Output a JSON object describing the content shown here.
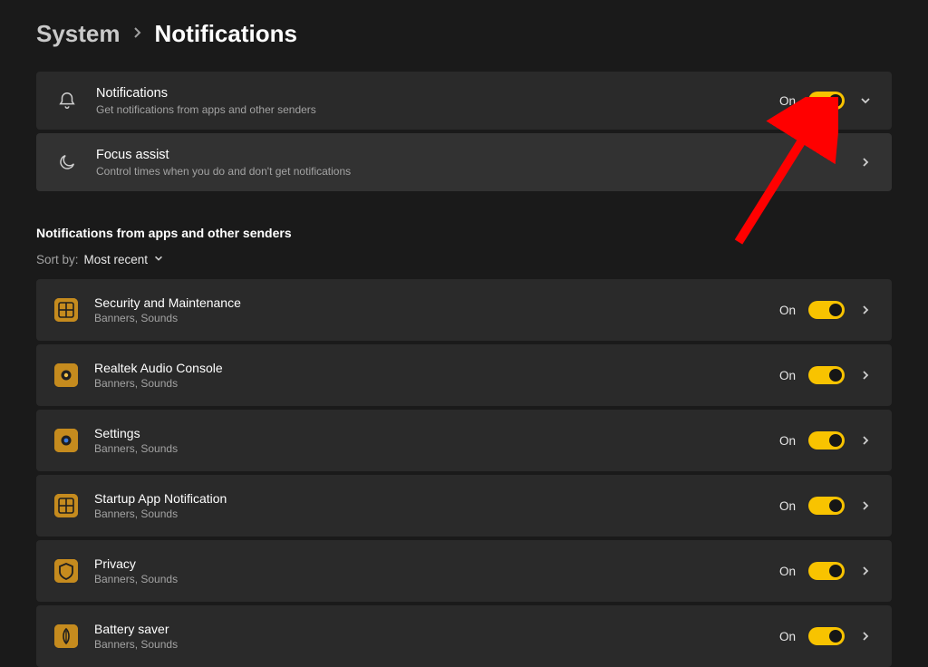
{
  "breadcrumb": {
    "parent": "System",
    "current": "Notifications"
  },
  "primary": {
    "notifications": {
      "title": "Notifications",
      "desc": "Get notifications from apps and other senders",
      "state": "On"
    },
    "focus": {
      "title": "Focus assist",
      "desc": "Control times when you do and don't get notifications"
    }
  },
  "section_heading": "Notifications from apps and other senders",
  "sort": {
    "label": "Sort by:",
    "value": "Most recent"
  },
  "apps": [
    {
      "name": "Security and Maintenance",
      "sub": "Banners, Sounds",
      "state": "On",
      "icon": "grid"
    },
    {
      "name": "Realtek Audio Console",
      "sub": "Banners, Sounds",
      "state": "On",
      "icon": "speaker"
    },
    {
      "name": "Settings",
      "sub": "Banners, Sounds",
      "state": "On",
      "icon": "gear"
    },
    {
      "name": "Startup App Notification",
      "sub": "Banners, Sounds",
      "state": "On",
      "icon": "grid"
    },
    {
      "name": "Privacy",
      "sub": "Banners, Sounds",
      "state": "On",
      "icon": "shield"
    },
    {
      "name": "Battery saver",
      "sub": "Banners, Sounds",
      "state": "On",
      "icon": "leaf"
    }
  ],
  "annotation": {
    "arrow_color": "#ff0000"
  }
}
